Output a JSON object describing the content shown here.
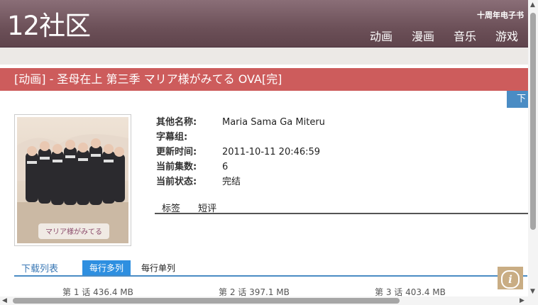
{
  "site": {
    "logo": "12社区",
    "ebook_link": "十周年电子书",
    "nav": [
      "动画",
      "漫画",
      "音乐",
      "游戏"
    ]
  },
  "page": {
    "title": "[动画] - 圣母在上 第三季 マリア様がみてる OVA[完]",
    "download_button": "下",
    "info": [
      {
        "label": "其他名称:",
        "value": "Maria Sama Ga Miteru"
      },
      {
        "label": "字幕组:",
        "value": ""
      },
      {
        "label": "更新时间:",
        "value": "2011-10-11 20:46:59"
      },
      {
        "label": "当前集数:",
        "value": "6"
      },
      {
        "label": "当前状态:",
        "value": "完结"
      }
    ],
    "tabs": [
      "标签",
      "短评"
    ],
    "download_list": {
      "title": "下载列表",
      "mode_multi": "每行多列",
      "mode_single": "每行单列",
      "episodes": [
        {
          "name": "第 1 话",
          "size": "436.4 MB"
        },
        {
          "name": "第 2 话",
          "size": "397.1 MB"
        },
        {
          "name": "第 3 话",
          "size": "403.4 MB"
        }
      ]
    }
  },
  "colors": {
    "header": "#6c5058",
    "title_bar": "#cd5c5c",
    "accent_blue": "#2e8fe0",
    "info_button": "#c9ad84"
  },
  "icons": {
    "info_button": "info-icon",
    "cover_logo_text": "マリア様がみてる"
  }
}
